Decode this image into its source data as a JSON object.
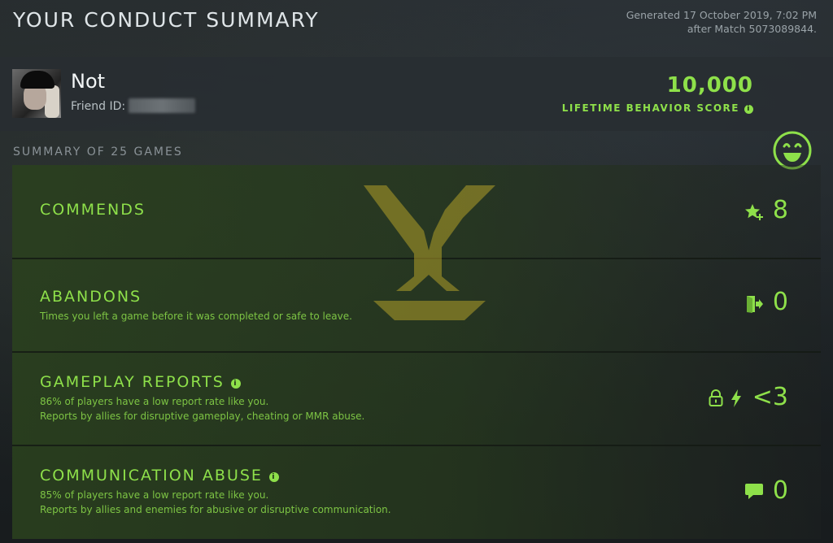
{
  "header": {
    "title": "YOUR CONDUCT SUMMARY",
    "generated_line1": "Generated 17 October 2019, 7:02 PM",
    "generated_line2": "after Match 5073089844."
  },
  "profile": {
    "username": "Not",
    "friend_id_label": "Friend ID:",
    "behavior_score": "10,000",
    "behavior_score_label": "LIFETIME BEHAVIOR SCORE",
    "info_glyph": "i"
  },
  "summary": {
    "label": "SUMMARY OF 25 GAMES",
    "rows": [
      {
        "title": "COMMENDS",
        "desc1": "",
        "desc2": "",
        "value": "8",
        "icon": "star-plus-icon"
      },
      {
        "title": "ABANDONS",
        "desc1": "Times you left a game before it was completed or safe to leave.",
        "desc2": "",
        "value": "0",
        "icon": "exit-door-icon"
      },
      {
        "title": "GAMEPLAY REPORTS",
        "desc1": "86% of players have a low report rate like you.",
        "desc2": "Reports by allies for disruptive gameplay, cheating or MMR abuse.",
        "value": "<3",
        "icon": "lock-lightning-icon"
      },
      {
        "title": "COMMUNICATION ABUSE",
        "desc1": "85% of players have a low report rate like you.",
        "desc2": "Reports by allies and enemies for abusive or disruptive communication.",
        "value": "0",
        "icon": "chat-bubble-icon"
      }
    ]
  },
  "colors": {
    "accent": "#8ee04a",
    "panel": "#2a401e",
    "background": "#1a1e20"
  }
}
